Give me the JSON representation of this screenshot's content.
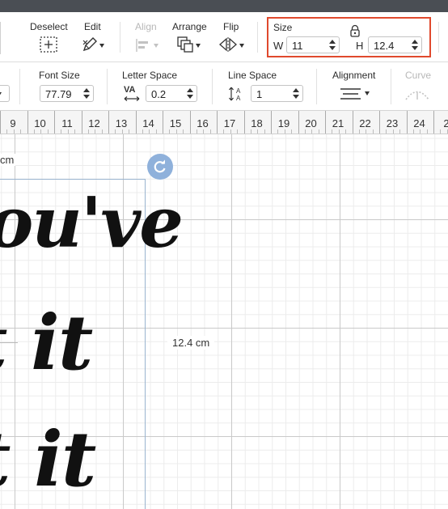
{
  "toolbar": {
    "deselect_label": "Deselect",
    "edit_label": "Edit",
    "align_label": "Align",
    "arrange_label": "Arrange",
    "flip_label": "Flip",
    "size": {
      "label": "Size",
      "w_label": "W",
      "w_value": "11",
      "h_label": "H",
      "h_value": "12.4",
      "lock_icon": "padlock-icon"
    },
    "highlight_color": "#e0492d"
  },
  "text_toolbar": {
    "font_size_label": "Font Size",
    "font_size_value": "77.79",
    "letter_space_label": "Letter Space",
    "letter_space_icon_text": "VA",
    "letter_space_value": "0.2",
    "line_space_label": "Line Space",
    "line_space_value": "1",
    "alignment_label": "Alignment",
    "curve_label": "Curve"
  },
  "ruler": {
    "ticks": [
      "9",
      "10",
      "11",
      "12",
      "13",
      "14",
      "15",
      "16",
      "17",
      "18",
      "19",
      "20",
      "21",
      "22",
      "23",
      "24",
      "2"
    ]
  },
  "canvas": {
    "partial_dim_label": "cm",
    "height_dim_label": "12.4 cm",
    "text_line_1": "ou've",
    "text_line_2": "t it",
    "text_line_3": "t it",
    "rotate_handle_color": "#8fb1db"
  }
}
